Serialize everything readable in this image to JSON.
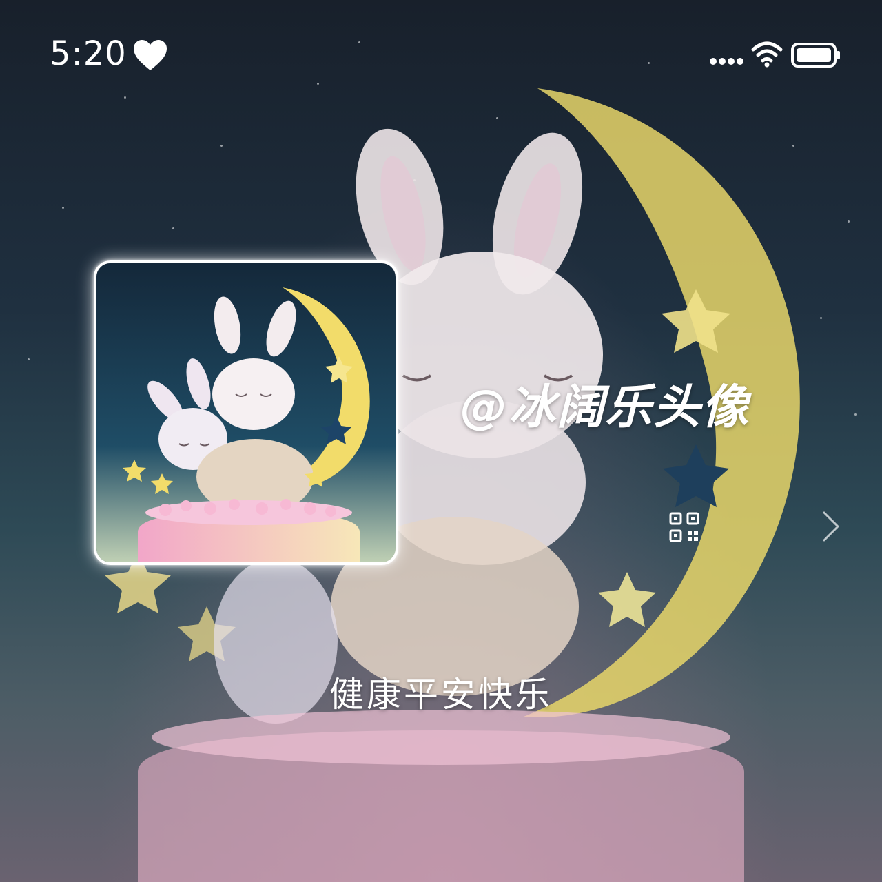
{
  "status_bar": {
    "time": "5:20",
    "left_icon": "heart-icon",
    "right_icons": [
      "signal-icon",
      "wifi-icon",
      "battery-icon"
    ]
  },
  "profile": {
    "username": "@冰阔乐头像",
    "signature": "健康平安快乐",
    "qr_icon": "qr-code-icon",
    "nav_icon": "chevron-right-icon"
  },
  "colors": {
    "text": "#ffffff",
    "moon": "#f2dc6a",
    "bunny": "#f3ecec",
    "cake": "#f3c6d8"
  }
}
